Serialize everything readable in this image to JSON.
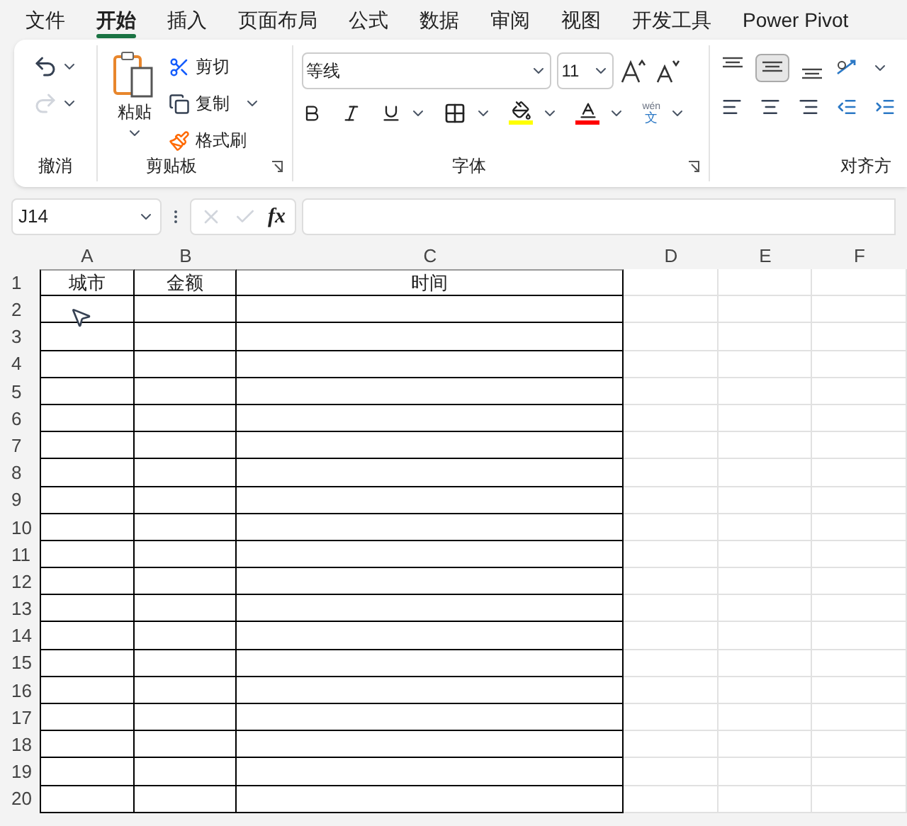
{
  "menu_tabs": [
    {
      "label": "文件",
      "selected": false
    },
    {
      "label": "开始",
      "selected": true
    },
    {
      "label": "插入",
      "selected": false
    },
    {
      "label": "页面布局",
      "selected": false
    },
    {
      "label": "公式",
      "selected": false
    },
    {
      "label": "数据",
      "selected": false
    },
    {
      "label": "审阅",
      "selected": false
    },
    {
      "label": "视图",
      "selected": false
    },
    {
      "label": "开发工具",
      "selected": false
    },
    {
      "label": "Power Pivot",
      "selected": false
    }
  ],
  "ribbon": {
    "undo_group": {
      "label": "撤消",
      "redo_disabled": true
    },
    "clipboard_group": {
      "label": "剪贴板",
      "paste": "粘贴",
      "cut": "剪切",
      "copy": "复制",
      "format_painter": "格式刷"
    },
    "font_group": {
      "label": "字体",
      "font_name": "等线",
      "font_size": "11",
      "phonetic_top": "wén",
      "phonetic_bottom": "文"
    },
    "alignment_group": {
      "label": "对齐方",
      "middle_align_selected": true
    }
  },
  "formula_bar": {
    "name_box": "J14",
    "function_label": "fx"
  },
  "sheet": {
    "columns": [
      {
        "label": "A"
      },
      {
        "label": "B"
      },
      {
        "label": "C"
      },
      {
        "label": "D"
      },
      {
        "label": "E"
      },
      {
        "label": "F"
      }
    ],
    "rows": [
      {
        "number": "1",
        "cells": [
          "城市",
          "金额",
          "时间"
        ]
      },
      {
        "number": "2"
      },
      {
        "number": "3"
      },
      {
        "number": "4"
      },
      {
        "number": "5"
      },
      {
        "number": "6"
      },
      {
        "number": "7"
      },
      {
        "number": "8"
      },
      {
        "number": "9"
      },
      {
        "number": "10"
      },
      {
        "number": "11"
      },
      {
        "number": "12"
      },
      {
        "number": "13"
      },
      {
        "number": "14"
      },
      {
        "number": "15"
      },
      {
        "number": "16"
      },
      {
        "number": "17"
      },
      {
        "number": "18"
      },
      {
        "number": "19"
      },
      {
        "number": "20"
      }
    ]
  }
}
